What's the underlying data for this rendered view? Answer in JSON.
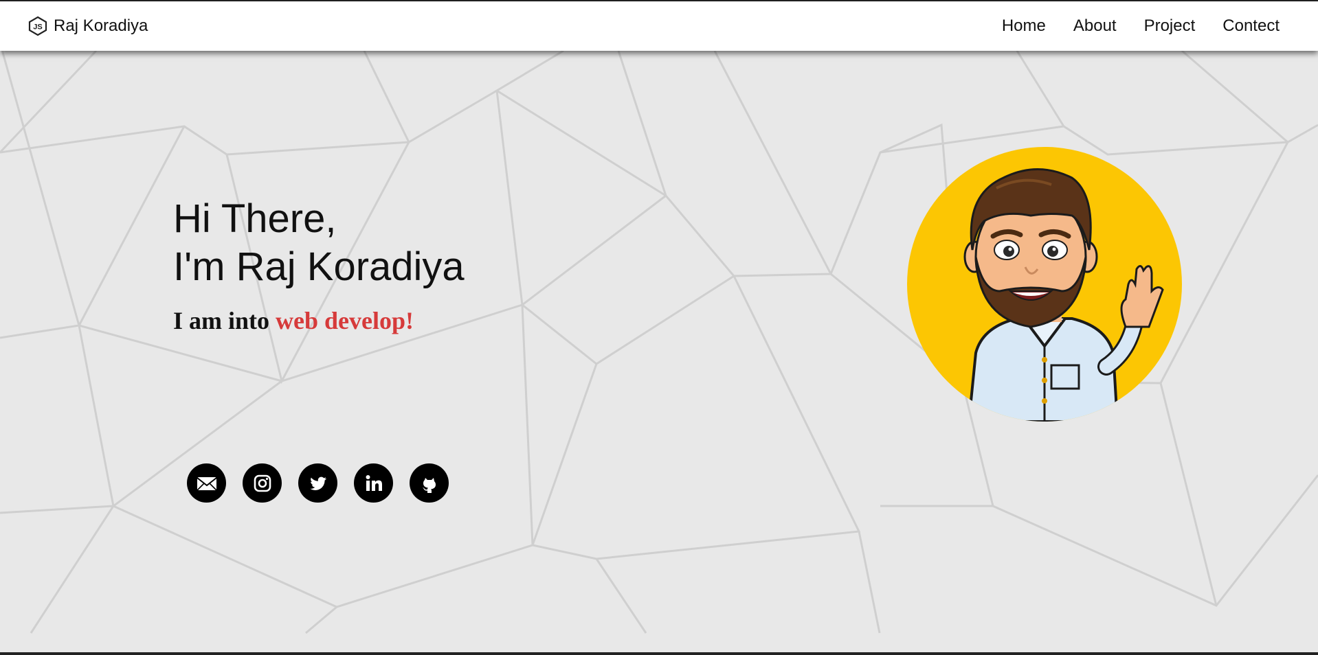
{
  "brand": {
    "name": "Raj Koradiya",
    "logo_icon": "nodejs-hex-icon"
  },
  "nav": [
    {
      "label": "Home"
    },
    {
      "label": "About"
    },
    {
      "label": "Project"
    },
    {
      "label": "Contect"
    }
  ],
  "hero": {
    "line1": "Hi There,",
    "line2": "I'm Raj Koradiya",
    "tagline_prefix": "I am into ",
    "tagline_highlight": "web develop!"
  },
  "social": [
    {
      "icon": "email-icon"
    },
    {
      "icon": "instagram-icon"
    },
    {
      "icon": "twitter-icon"
    },
    {
      "icon": "linkedin-icon"
    },
    {
      "icon": "github-icon"
    }
  ],
  "avatar": {
    "icon": "cartoon-avatar"
  },
  "colors": {
    "background": "#e8e8e8",
    "accent": "#d63a3a",
    "avatar_bg": "#fcc603"
  }
}
